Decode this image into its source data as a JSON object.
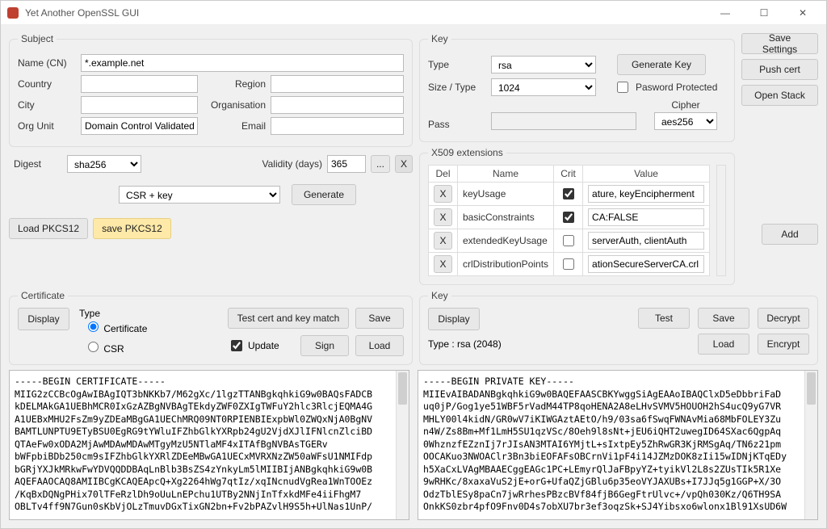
{
  "window": {
    "title": "Yet Another OpenSSL GUI"
  },
  "rightButtons": {
    "save": "Save Settings",
    "push": "Push cert",
    "open": "Open Stack",
    "add": "Add"
  },
  "subject": {
    "legend": "Subject",
    "nameLabel": "Name (CN)",
    "name": "*.example.net",
    "countryLabel": "Country",
    "country": "",
    "regionLabel": "Region",
    "region": "",
    "cityLabel": "City",
    "city": "",
    "orgLabel": "Organisation",
    "org": "",
    "ouLabel": "Org Unit",
    "ou": "Domain Control Validated",
    "emailLabel": "Email",
    "email": ""
  },
  "digest": {
    "label": "Digest",
    "value": "sha256",
    "validityLabel": "Validity (days)",
    "validity": "365",
    "dots": "...",
    "x": "X"
  },
  "gen": {
    "mode": "CSR + key",
    "btn": "Generate"
  },
  "pkcs": {
    "load": "Load PKCS12",
    "save": "save PKCS12"
  },
  "key": {
    "legend": "Key",
    "typeLabel": "Type",
    "type": "rsa",
    "genBtn": "Generate Key",
    "sizeLabel": "Size / Type",
    "size": "1024",
    "pwProtLabel": "Pasword Protected",
    "passLabel": "Pass",
    "pass": "",
    "cipherLabel": "Cipher",
    "cipher": "aes256"
  },
  "ext": {
    "legend": "X509 extensions",
    "headers": {
      "del": "Del",
      "name": "Name",
      "crit": "Crit",
      "value": "Value"
    },
    "rows": [
      {
        "del": "X",
        "name": "keyUsage",
        "crit": true,
        "value": "ature, keyEncipherment"
      },
      {
        "del": "X",
        "name": "basicConstraints",
        "crit": true,
        "value": "CA:FALSE"
      },
      {
        "del": "X",
        "name": "extendedKeyUsage",
        "crit": false,
        "value": "serverAuth, clientAuth"
      },
      {
        "del": "X",
        "name": "crlDistributionPoints",
        "crit": false,
        "value": "ationSecureServerCA.crl"
      }
    ]
  },
  "certPanel": {
    "legend": "Certificate",
    "display": "Display",
    "typeLabel": "Type",
    "rCert": "Certificate",
    "rCsr": "CSR",
    "testMatch": "Test cert and key match",
    "save": "Save",
    "update": "Update",
    "sign": "Sign",
    "load": "Load"
  },
  "keyPanel": {
    "legend": "Key",
    "display": "Display",
    "typeLine": "Type :   rsa (2048)",
    "test": "Test",
    "save": "Save",
    "decrypt": "Decrypt",
    "load": "Load",
    "encrypt": "Encrypt"
  },
  "certText": "-----BEGIN CERTIFICATE-----\nMIIG2zCCBcOgAwIBAgIQT3bNKKb7/M62gXc/1lgzTTANBgkqhkiG9w0BAQsFADCB\nkDELMAkGA1UEBhMCR0IxGzAZBgNVBAgTEkdyZWF0ZXIgTWFuY2hlc3RlcjEQMA4G\nA1UEBxMHU2FsZm9yZDEaMBgGA1UEChMRQ09NT0RPIENBIExpbWl0ZWQxNjA0BgNV\nBAMTLUNPTU9ETyBSU0EgRG9tYWluIFZhbGlkYXRpb24gU2VjdXJlIFNlcnZlciBD\nQTAeFw0xODA2MjAwMDAwMDAwMTgyMzU5NTlaMF4xITAfBgNVBAsTGERv\nbWFpbiBDb250cm9sIFZhbGlkYXRlZDEeMBwGA1UECxMVRXNzZW50aWFsU1NMIFdp\nbGRjYXJkMRkwFwYDVQQDDBAqLnBlb3BsZS4zYnkyLm5lMIIBIjANBgkqhkiG9w0B\nAQEFAAOCAQ8AMIIBCgKCAQEApcQ+Xg2264hWg7qtIz/xqINcnudVgRea1WnTOOEz\n/KqBxDQNgPHix70lTFeRzlDh9oUuLnEPchu1UTBy2NNjInTfxkdMFe4iiFhgM7\nOBLTv4ff9N7Gun0sKbVjOLzTmuvDGxTixGN2bn+Fv2bPAZvlH9S5h+UlNas1UnP/",
  "keyText": "-----BEGIN PRIVATE KEY-----\nMIIEvAIBADANBgkqhkiG9w0BAQEFAASCBKYwggSiAgEAAoIBAQClxD5eDbbriFaD\nuq0jP/Gog1ye51WBF5rVadM44TP8qoHENA2A8eLHvSVMV5HOUOH2hS4ucQ9yG7VR\nMHLY00l4kidN/GR0wV7iKIWGAztAEtO/h9/03sa6fSwqFWNAvMia68MbFOLEY3Zu\nn4W/Zs8Bm+Mf1LmH5SU1qzVSc/8Oeh9l8sNt+jEU6iQHT2uwegID64SXac6QgpAq\n0WhznzfEZznIj7rJIsAN3MTAI6YMjtL+sIxtpEy5ZhRwGR3KjRMSgAq/TN6z21pm\nOOCAKuo3NWOAClr3Bn3biEOFAFsOBCrnVi1pF4i14JZMzDOK8zIi15wIDNjKTqEDy\nh5XaCxLVAgMBAAECggEAGc1PC+LEmyrQlJaFBpyYZ+tyikVl2L8s2ZUsTIk5R1Xe\n9wRHKc/8xaxaVuS2jE+orG+UfaQZjGBlu6p35eoVYJAXUBs+I7JJq5g1GGP+X/3O\nOdzTblESy8paCn7jwRrhesPBzcBVf84fjB6GegFtrUlvc+/vpQh030Kz/Q6TH9SA\nOnkKS0zbr4pfO9Fnv0D4s7obXU7br3ef3oqzSk+SJ4Yibsxo6wlonx1Bl91XsUD6W"
}
